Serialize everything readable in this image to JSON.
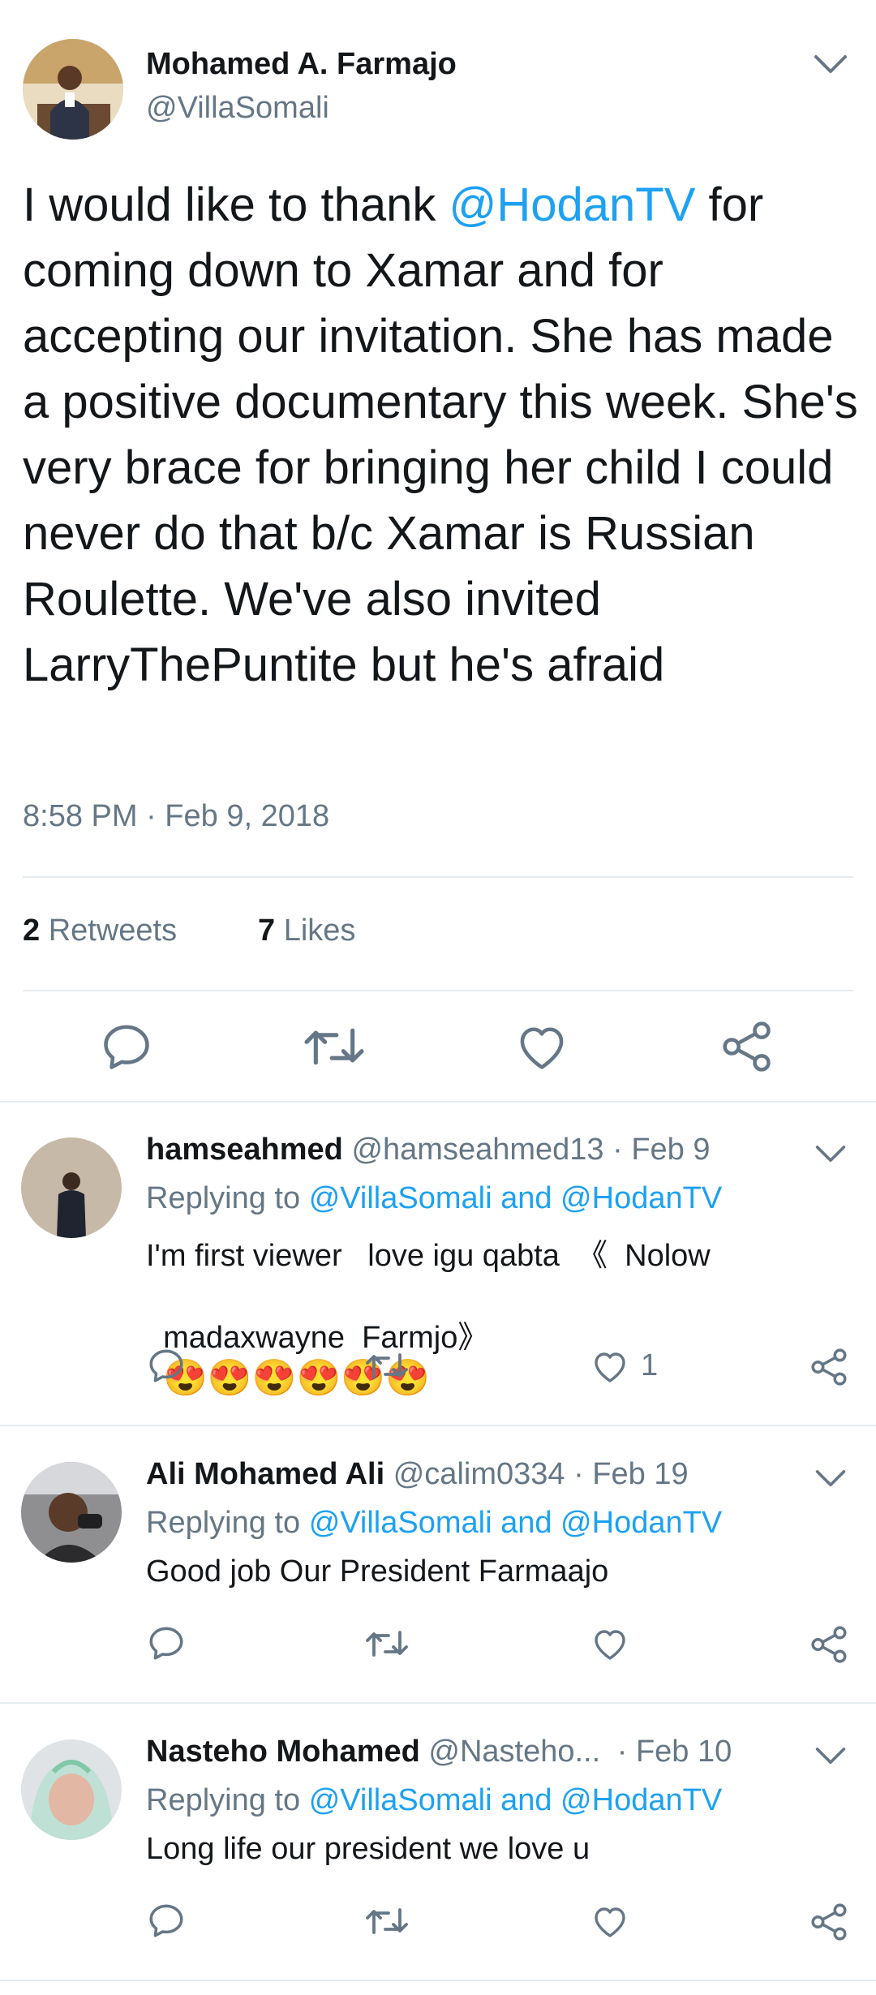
{
  "tweet": {
    "author_name": "Mohamed A. Farmajo",
    "author_handle": "@VillaSomali",
    "text_before_mention": "I would like to thank ",
    "mention": "@HodanTV",
    "text_after_mention": " for coming down to Xamar and for accepting our invitation. She has made a positive documentary this week. She's very brace for bringing her child I could never do that b/c Xamar is Russian Roulette. We've also invited LarryThePuntite but he's afraid",
    "timestamp": "8:58 PM · Feb 9, 2018",
    "retweets_count": "2",
    "retweets_label": "Retweets",
    "likes_count": "7",
    "likes_label": "Likes"
  },
  "replies": [
    {
      "name": "hamseahmed",
      "handle": "@hamseahmed13",
      "date": "· Feb 9",
      "replying_prefix": "Replying to",
      "replying_targets": "@VillaSomali and @HodanTV",
      "text_line1": "I'm first viewer   love igu qabta  《  Nolow",
      "text_line2": "madaxwayne  Farmjo》",
      "emoji": "😍😍😍😍😍😍",
      "like_count": "1"
    },
    {
      "name": "Ali Mohamed Ali",
      "handle": "@calim0334",
      "date": "· Feb 19",
      "replying_prefix": "Replying to",
      "replying_targets": "@VillaSomali and @HodanTV",
      "text_line1": "Good job Our President Farmaajo"
    },
    {
      "name": "Nasteho Mohamed",
      "handle": "@Nasteho...",
      "date": "· Feb 10",
      "replying_prefix": "Replying to",
      "replying_targets": "@VillaSomali and @HodanTV",
      "text_line1": "Long life our president we love u"
    }
  ],
  "icons": {
    "reply": "reply-icon",
    "retweet": "retweet-icon",
    "like": "heart-icon",
    "share": "share-icon",
    "menu": "chevron-down-icon"
  },
  "colors": {
    "link": "#1da1f2",
    "muted": "#657786",
    "text": "#14171a",
    "divider": "#e6ecf0"
  }
}
